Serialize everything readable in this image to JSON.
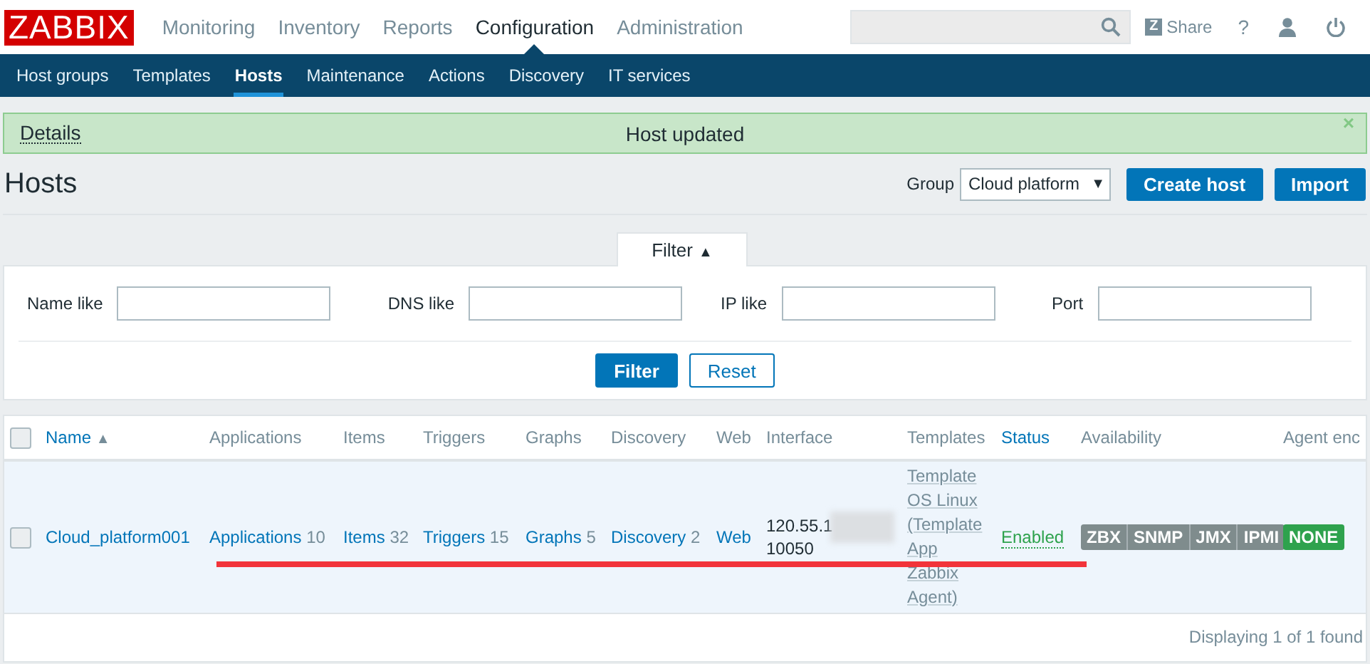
{
  "header": {
    "logo": "ZABBIX",
    "menu": [
      {
        "label": "Monitoring",
        "selected": false
      },
      {
        "label": "Inventory",
        "selected": false
      },
      {
        "label": "Reports",
        "selected": false
      },
      {
        "label": "Configuration",
        "selected": true
      },
      {
        "label": "Administration",
        "selected": false
      }
    ],
    "share": {
      "icon": "Z",
      "label": "Share"
    },
    "help": "?"
  },
  "submenu": [
    {
      "label": "Host groups",
      "selected": false
    },
    {
      "label": "Templates",
      "selected": false
    },
    {
      "label": "Hosts",
      "selected": true
    },
    {
      "label": "Maintenance",
      "selected": false
    },
    {
      "label": "Actions",
      "selected": false
    },
    {
      "label": "Discovery",
      "selected": false
    },
    {
      "label": "IT services",
      "selected": false
    }
  ],
  "message": {
    "details": "Details",
    "text": "Host updated",
    "close": "×"
  },
  "page_title": "Hosts",
  "group_filter": {
    "label": "Group",
    "value": "Cloud platform",
    "arrow": "▼"
  },
  "buttons": [
    "Create host",
    "Import"
  ],
  "filter": {
    "tab": "Filter",
    "arrow": "▲",
    "expanded": true,
    "fields": [
      {
        "label": "Name like"
      },
      {
        "label": "DNS like"
      },
      {
        "label": "IP like"
      },
      {
        "label": "Port"
      }
    ],
    "buttons": [
      "Filter",
      "Reset"
    ]
  },
  "table": {
    "select_all": {
      "checked": false
    },
    "columns": [
      {
        "label": "Name",
        "sortable": true,
        "sort_mark": "▲"
      },
      {
        "label": "Applications",
        "sortable": false
      },
      {
        "label": "Items",
        "sortable": false
      },
      {
        "label": "Triggers",
        "sortable": false
      },
      {
        "label": "Graphs",
        "sortable": false
      },
      {
        "label": "Discovery",
        "sortable": false
      },
      {
        "label": "Web",
        "sortable": false
      },
      {
        "label": "Interface",
        "sortable": false
      },
      {
        "label": "Templates",
        "sortable": false
      },
      {
        "label": "Status",
        "sortable": true
      },
      {
        "label": "Availability",
        "sortable": false
      },
      {
        "label": "Agent enc",
        "sortable": false
      }
    ],
    "rows": [
      {
        "checked": false,
        "name": "Cloud_platform001",
        "applications": {
          "link": "Applications",
          "count": "10"
        },
        "items": {
          "link": "Items",
          "count": "32"
        },
        "triggers": {
          "link": "Triggers",
          "count": "15"
        },
        "graphs": {
          "link": "Graphs",
          "count": "5"
        },
        "discovery": {
          "link": "Discovery",
          "count": "2"
        },
        "web": "Web",
        "interface": [
          "120.55.1",
          "10050"
        ],
        "templates": [
          "Template OS Linux",
          "(Template App Zabbix Agent)"
        ],
        "status": {
          "label": "Enabled",
          "kind": "enabled"
        },
        "availability": [
          {
            "label": "ZBX",
            "color": "#7f8c8d"
          },
          {
            "label": "SNMP",
            "color": "#7f8c8d"
          },
          {
            "label": "JMX",
            "color": "#7f8c8d"
          },
          {
            "label": "IPMI",
            "color": "#7f8c8d"
          }
        ],
        "encryption": {
          "label": "NONE",
          "color": "#2ea24d"
        }
      }
    ],
    "footer": "Displaying 1 of 1 found"
  },
  "annotation": {
    "kind": "underline"
  }
}
